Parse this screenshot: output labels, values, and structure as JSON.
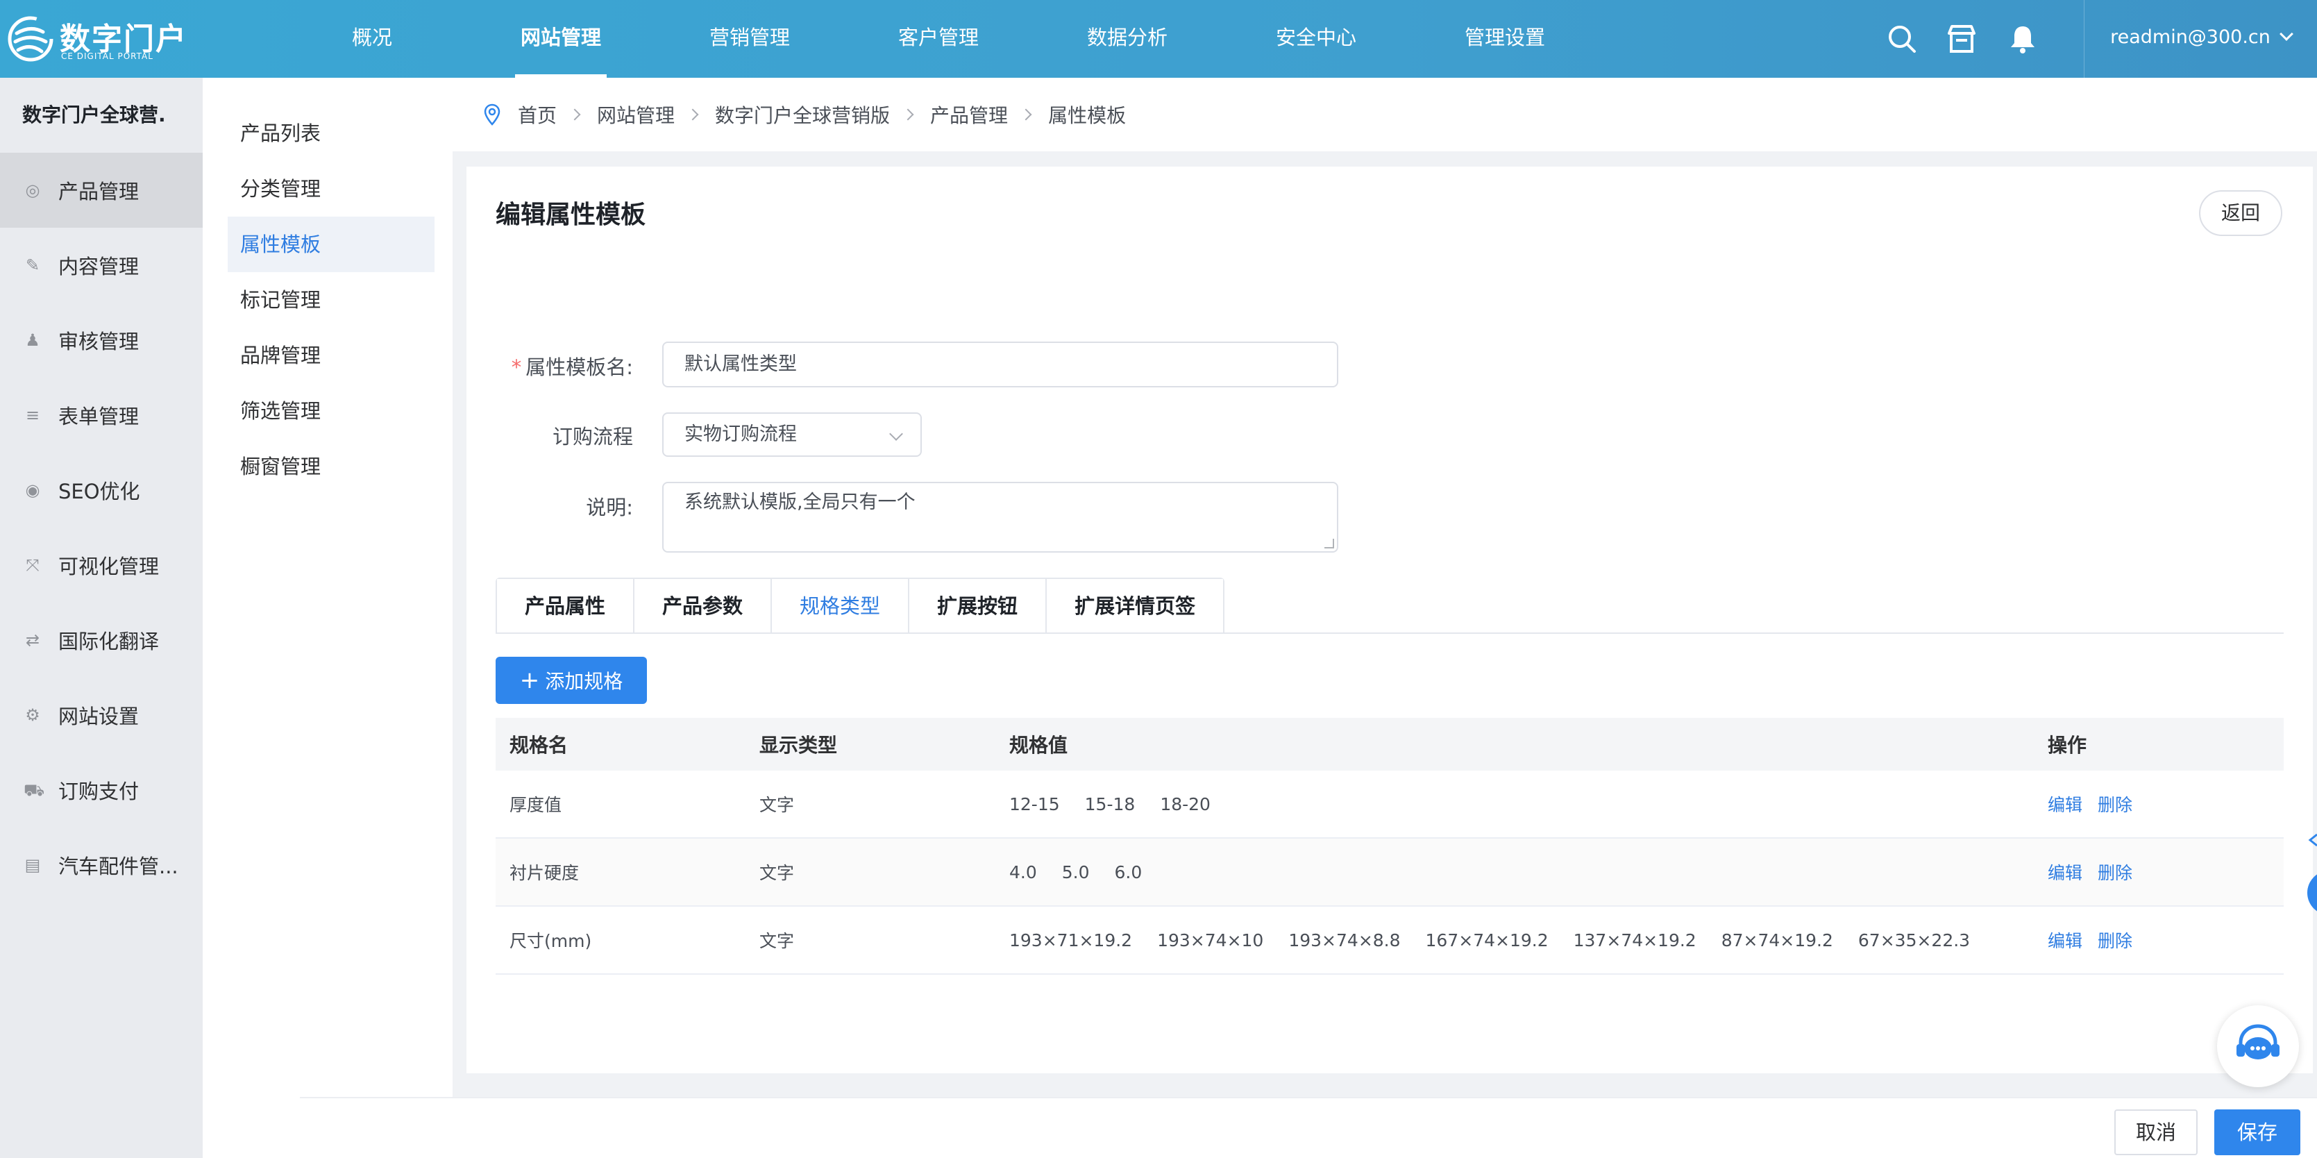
{
  "app": {
    "logo_title": "数字门户",
    "logo_subtitle": "CE DIGITAL PORTAL"
  },
  "topnav": {
    "items": [
      {
        "label": "概况"
      },
      {
        "label": "网站管理",
        "active": true
      },
      {
        "label": "营销管理"
      },
      {
        "label": "客户管理"
      },
      {
        "label": "数据分析"
      },
      {
        "label": "安全中心"
      },
      {
        "label": "管理设置"
      }
    ],
    "icons": [
      "search-icon",
      "store-icon",
      "bell-icon"
    ],
    "user": "readmin@300.cn"
  },
  "sidebar": {
    "title": "数字门户全球营.",
    "items": [
      {
        "label": "产品管理",
        "icon": "product-icon",
        "active": true
      },
      {
        "label": "内容管理",
        "icon": "edit-icon"
      },
      {
        "label": "审核管理",
        "icon": "user-icon"
      },
      {
        "label": "表单管理",
        "icon": "list-icon"
      },
      {
        "label": "SEO优化",
        "icon": "target-icon"
      },
      {
        "label": "可视化管理",
        "icon": "expand-icon"
      },
      {
        "label": "国际化翻译",
        "icon": "translate-icon"
      },
      {
        "label": "网站设置",
        "icon": "gear-icon"
      },
      {
        "label": "订购支付",
        "icon": "cart-icon"
      },
      {
        "label": "汽车配件管...",
        "icon": "document-icon"
      }
    ]
  },
  "submenu": {
    "items": [
      {
        "label": "产品列表"
      },
      {
        "label": "分类管理"
      },
      {
        "label": "属性模板",
        "active": true
      },
      {
        "label": "标记管理"
      },
      {
        "label": "品牌管理"
      },
      {
        "label": "筛选管理"
      },
      {
        "label": "橱窗管理"
      }
    ]
  },
  "breadcrumb": [
    "首页",
    "网站管理",
    "数字门户全球营销版",
    "产品管理",
    "属性模板"
  ],
  "page": {
    "title": "编辑属性模板",
    "back_label": "返回"
  },
  "form": {
    "template_name_label": "属性模板名:",
    "template_name_value": "默认属性类型",
    "order_flow_label": "订购流程",
    "order_flow_value": "实物订购流程",
    "description_label": "说明:",
    "description_value": "系统默认模版,全局只有一个"
  },
  "tabs": [
    {
      "label": "产品属性"
    },
    {
      "label": "产品参数"
    },
    {
      "label": "规格类型",
      "active": true
    },
    {
      "label": "扩展按钮"
    },
    {
      "label": "扩展详情页签"
    }
  ],
  "add_spec_label": "添加规格",
  "table": {
    "headers": [
      "规格名",
      "显示类型",
      "规格值",
      "操作"
    ],
    "rows": [
      {
        "name": "厚度值",
        "type": "文字",
        "values": [
          "12-15",
          "15-18",
          "18-20"
        ]
      },
      {
        "name": "衬片硬度",
        "type": "文字",
        "values": [
          "4.0",
          "5.0",
          "6.0"
        ]
      },
      {
        "name": "尺寸(mm)",
        "type": "文字",
        "values": [
          "193×71×19.2",
          "193×74×10",
          "193×74×8.8",
          "167×74×19.2",
          "137×74×19.2",
          "87×74×19.2",
          "67×35×22.3"
        ]
      }
    ],
    "edit_label": "编辑",
    "delete_label": "删除"
  },
  "footer": {
    "cancel_label": "取消",
    "save_label": "保存"
  },
  "colors": {
    "topbar": "#3aa7d4",
    "primary": "#2f86ec",
    "link": "#2f7de1",
    "required": "#f56c6c"
  }
}
